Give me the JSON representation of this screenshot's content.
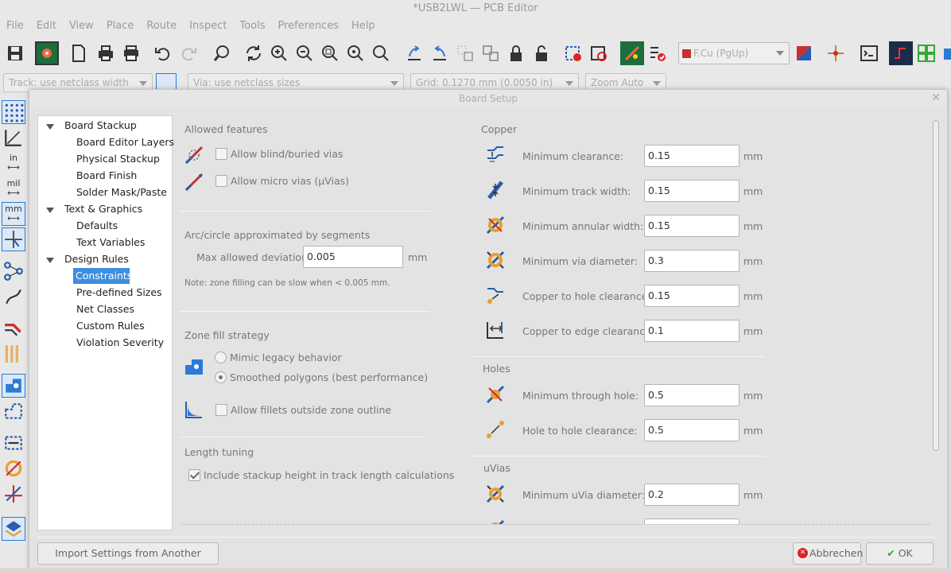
{
  "window": {
    "title": "*USB2LWL — PCB Editor"
  },
  "menu": [
    "File",
    "Edit",
    "View",
    "Place",
    "Route",
    "Inspect",
    "Tools",
    "Preferences",
    "Help"
  ],
  "toolbar": {
    "layer": "F.Cu (PgUp)",
    "layer_color": "#c83030"
  },
  "toolbar2": {
    "track": "Track: use netclass width",
    "via": "Via: use netclass sizes",
    "grid": "Grid: 0.1270 mm (0.0050 in)",
    "zoom": "Zoom Auto"
  },
  "left": {
    "in": "in",
    "mil": "mil",
    "mm": "mm"
  },
  "dialog": {
    "title": "Board Setup",
    "tree": {
      "board_stackup": "Board Stackup",
      "board_editor_layers": "Board Editor Layers",
      "physical_stackup": "Physical Stackup",
      "board_finish": "Board Finish",
      "solder_mask": "Solder Mask/Paste",
      "text_graphics": "Text & Graphics",
      "defaults": "Defaults",
      "text_variables": "Text Variables",
      "design_rules": "Design Rules",
      "constraints": "Constraints",
      "predefined_sizes": "Pre-defined Sizes",
      "net_classes": "Net Classes",
      "custom_rules": "Custom Rules",
      "violation_severity": "Violation Severity"
    },
    "allowed": {
      "title": "Allowed features",
      "blind": "Allow blind/buried vias",
      "micro": "Allow micro vias (µVias)"
    },
    "arc": {
      "title": "Arc/circle approximated by segments",
      "label": "Max allowed deviation:",
      "value": "0.005",
      "unit": "mm",
      "note": "Note: zone filling can be slow when < 0.005 mm."
    },
    "zone": {
      "title": "Zone fill strategy",
      "legacy": "Mimic legacy behavior",
      "smoothed": "Smoothed polygons (best performance)",
      "fillets": "Allow fillets outside zone outline"
    },
    "length": {
      "title": "Length tuning",
      "stackup": "Include stackup height in track length calculations"
    },
    "copper": {
      "title": "Copper",
      "rows": [
        {
          "label": "Minimum clearance:",
          "value": "0.15",
          "unit": "mm"
        },
        {
          "label": "Minimum track width:",
          "value": "0.15",
          "unit": "mm"
        },
        {
          "label": "Minimum annular width:",
          "value": "0.15",
          "unit": "mm"
        },
        {
          "label": "Minimum via diameter:",
          "value": "0.3",
          "unit": "mm"
        },
        {
          "label": "Copper to hole clearance:",
          "value": "0.15",
          "unit": "mm"
        },
        {
          "label": "Copper to edge clearance:",
          "value": "0.1",
          "unit": "mm"
        }
      ]
    },
    "holes": {
      "title": "Holes",
      "rows": [
        {
          "label": "Minimum through hole:",
          "value": "0.5",
          "unit": "mm"
        },
        {
          "label": "Hole to hole clearance:",
          "value": "0.5",
          "unit": "mm"
        }
      ]
    },
    "uvias": {
      "title": "uVias",
      "rows": [
        {
          "label": "Minimum uVia diameter:",
          "value": "0.2",
          "unit": "mm"
        }
      ]
    },
    "buttons": {
      "import": "Import Settings from Another Board...",
      "cancel": "Abbrechen",
      "ok": "OK"
    }
  }
}
